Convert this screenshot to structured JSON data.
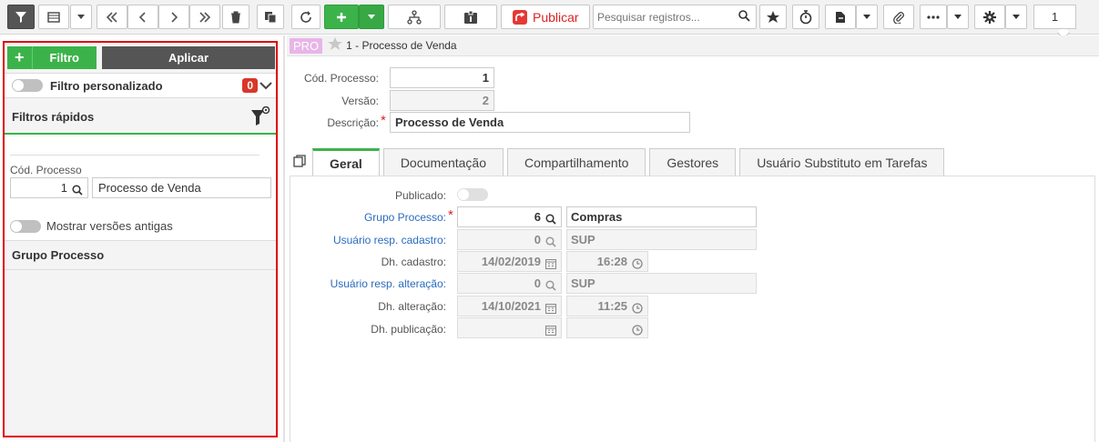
{
  "toolbar": {
    "publicar_label": "Publicar",
    "search_placeholder": "Pesquisar registros...",
    "page_number": "1"
  },
  "left_panel": {
    "filtro_button": "Filtro",
    "aplicar_button": "Aplicar",
    "filtro_personalizado": "Filtro personalizado",
    "filtro_count": "0",
    "filtros_rapidos": "Filtros rápidos",
    "cod_processo_label": "Cód. Processo",
    "cod_processo_value": "1",
    "processo_name_value": "Processo de Venda",
    "mostrar_versoes": "Mostrar versões antigas",
    "grupo_processo": "Grupo Processo"
  },
  "header": {
    "badge": "PRO",
    "title": "1 - Processo de Venda"
  },
  "form": {
    "cod_label": "Cód. Processo:",
    "cod_value": "1",
    "versao_label": "Versão:",
    "versao_value": "2",
    "descricao_label": "Descrição:",
    "descricao_value": "Processo de Venda"
  },
  "tabs": [
    {
      "label": "Geral"
    },
    {
      "label": "Documentação"
    },
    {
      "label": "Compartilhamento"
    },
    {
      "label": "Gestores"
    },
    {
      "label": "Usuário Substituto em Tarefas"
    }
  ],
  "geral": {
    "publicado_label": "Publicado:",
    "grupo_label": "Grupo Processo:",
    "grupo_code": "6",
    "grupo_name": "Compras",
    "usr_cad_label": "Usuário resp. cadastro:",
    "usr_cad_code": "0",
    "usr_cad_name": "SUP",
    "dh_cad_label": "Dh. cadastro:",
    "dh_cad_date": "14/02/2019",
    "dh_cad_time": "16:28",
    "usr_alt_label": "Usuário resp. alteração:",
    "usr_alt_code": "0",
    "usr_alt_name": "SUP",
    "dh_alt_label": "Dh. alteração:",
    "dh_alt_date": "14/10/2021",
    "dh_alt_time": "11:25",
    "dh_pub_label": "Dh. publicação:"
  },
  "colors": {
    "accent_green": "#3cb34a",
    "required_red": "#d22222",
    "link_blue": "#2a6bbf",
    "highlight_border": "#e00000"
  }
}
